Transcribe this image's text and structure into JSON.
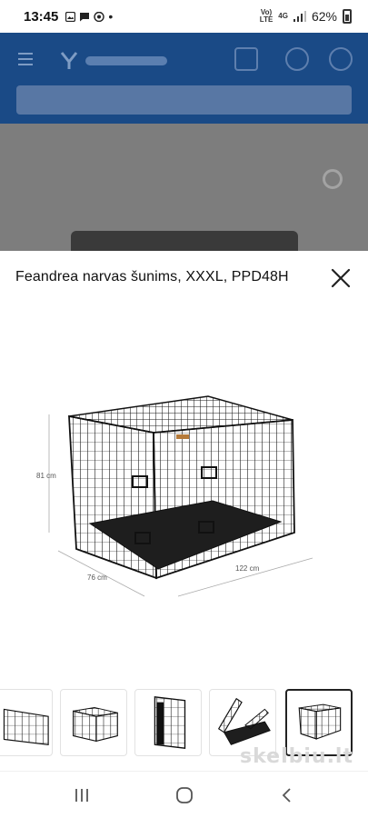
{
  "status": {
    "time": "13:45",
    "net_top": "Vo)",
    "net_bottom": "LTE",
    "network": "4G",
    "battery": "62%"
  },
  "sheet": {
    "title": "Feandrea narvas šunims, XXXL, PPD48H",
    "dimensions": {
      "height": "81 cm",
      "depth": "76 cm",
      "width": "122 cm"
    }
  },
  "thumbnails": [
    {
      "name": "thumb-crate-partial",
      "active": false
    },
    {
      "name": "thumb-crate-open-door",
      "active": false
    },
    {
      "name": "thumb-crate-folded",
      "active": false
    },
    {
      "name": "thumb-crate-collapsing",
      "active": false
    },
    {
      "name": "thumb-crate-dimensions",
      "active": true
    }
  ],
  "watermark": "skelbiu.lt",
  "colors": {
    "site_header": "#1a4a86",
    "overlay": "#7d7d7d",
    "text": "#111111"
  },
  "icons": {
    "close": "close-icon",
    "nav_recents": "recents-icon",
    "nav_home": "home-icon",
    "nav_back": "back-icon"
  }
}
